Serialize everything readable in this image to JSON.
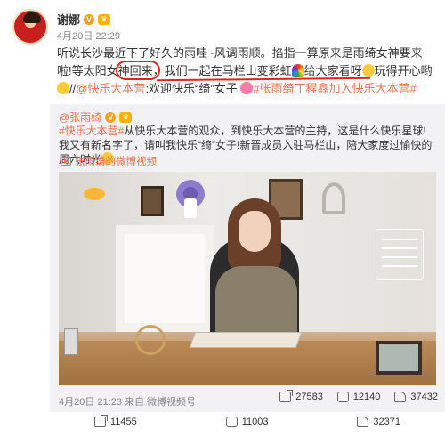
{
  "author": {
    "name": "谢娜",
    "time": "4月20日 22:29"
  },
  "post": {
    "text_a": "听说长沙最近下了好久的雨哇~风调雨顺。掐指一算原来是雨绮女神要来啦!等太阳女神回来，",
    "text_b": "我们一起在马栏山变彩虹",
    "text_c": "给大家看呀",
    "text_d": "玩得开心哟",
    "text_e": "//",
    "mention": "@快乐大本营",
    "text_f": ":欢迎快乐“绮”女子!",
    "topic": "#张雨绮丁程鑫加入快乐大本营#"
  },
  "repost": {
    "author": "@张雨绮",
    "line1_tag": "#快乐大本营#",
    "line1": "从快乐大本营的观众，到快乐大本营的主持，这是什么快乐星球!",
    "line2": "我又有新名字了，请叫我快乐“绮”女子!新晋成员入驻马栏山，陪大家度过愉快的周六时光",
    "video_link": "张雨绮的微博视频",
    "meta": "4月20日 21:23  来自 微博视频号",
    "stats": {
      "reposts": "27583",
      "comments": "12140",
      "likes": "37432"
    }
  },
  "bottom": {
    "repost_count": "11455",
    "comment_count": "11003",
    "like_count": "32371"
  },
  "colors": {
    "link": "#eb7350",
    "annotation": "#e0241b",
    "repost_bg": "#f2f2f5"
  }
}
